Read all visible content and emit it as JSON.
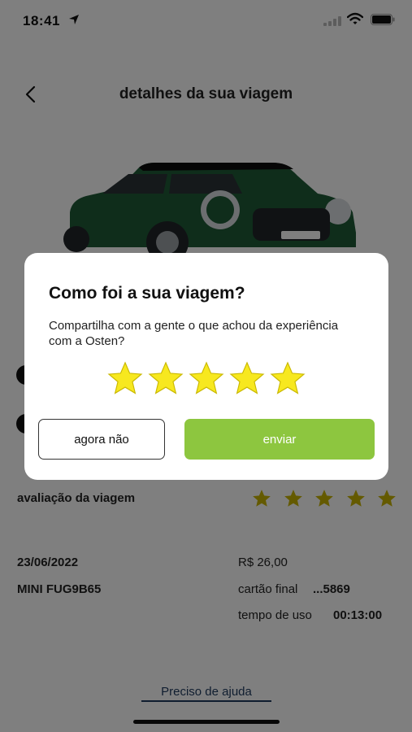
{
  "status_bar": {
    "time": "18:41",
    "icons": [
      "location-arrow-icon",
      "signal-icon",
      "wifi-icon",
      "battery-icon"
    ]
  },
  "header": {
    "title": "detalhes da sua viagem",
    "back_icon": "chevron-left-icon"
  },
  "trip": {
    "rating_label": "avaliação da viagem",
    "rating_value": 5,
    "rating_max": 5,
    "date": "23/06/2022",
    "car": "MINI FUG9B65",
    "price": "R$ 26,00",
    "card_label": "cartão final",
    "card_number": "...5869",
    "usage_label": "tempo de uso",
    "usage_time": "00:13:00"
  },
  "help_link": "Preciso de ajuda",
  "modal": {
    "title": "Como foi a sua viagem?",
    "description": "Compartilha com a gente o que achou da experiência com a Osten?",
    "stars_selected": 5,
    "stars_total": 5,
    "later_label": "agora não",
    "send_label": "enviar"
  },
  "colors": {
    "accent_green": "#8dc63f",
    "star_yellow": "#f7e81f",
    "star_dim": "#c8b400",
    "car_green": "#1f5a37",
    "link_blue": "#1e3a5f",
    "overlay": "rgba(0,0,0,0.5)"
  }
}
